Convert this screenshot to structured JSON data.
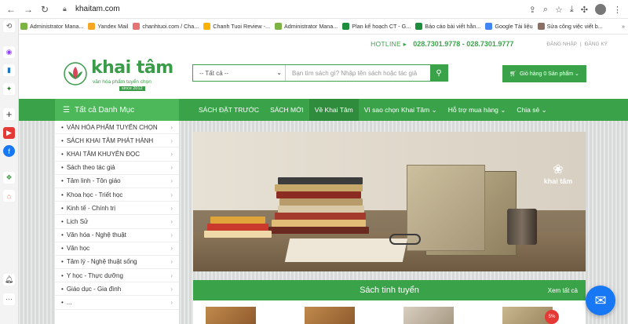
{
  "browser": {
    "url": "khaitam.com"
  },
  "bookmarks": [
    {
      "label": "Administrator Mana...",
      "color": "#7cb342"
    },
    {
      "label": "Yandex Mail",
      "color": "#f5a623"
    },
    {
      "label": "chanhtuoi.com / Cha...",
      "color": "#e57373"
    },
    {
      "label": "Chanh Tuoi Review -...",
      "color": "#ffb300"
    },
    {
      "label": "Administrator Mana...",
      "color": "#7cb342"
    },
    {
      "label": "Plan kế hoạch CT - G...",
      "color": "#1e8e3e"
    },
    {
      "label": "Báo cáo bài viết hằn...",
      "color": "#1e8e3e"
    },
    {
      "label": "Google Tài liệu",
      "color": "#4285f4"
    },
    {
      "label": "Sửa công việc viết b...",
      "color": "#8d6e63"
    }
  ],
  "topbar": {
    "hotline_label": "HOTLINE ▸",
    "hotline_number": "028.7301.9778 - 028.7301.9777",
    "login": "ĐĂNG NHẬP",
    "register": "ĐĂNG KÝ"
  },
  "logo": {
    "name": "khai tâm",
    "tagline": "văn hóa phẩm tuyển chọn",
    "since": "since 2012"
  },
  "search": {
    "category": "-- Tất cả --",
    "placeholder": "Bạn tìm sách gì? Nhập tên sách hoặc tác giả"
  },
  "cart": {
    "label": "Giỏ hàng 0 Sản phẩm ⌄"
  },
  "nav": {
    "all_categories": "Tất cả Danh Mục",
    "items": [
      {
        "label": "SÁCH ĐẶT TRƯỚC",
        "active": false
      },
      {
        "label": "SÁCH MỚI",
        "active": false
      },
      {
        "label": "Về Khai Tâm",
        "active": true
      },
      {
        "label": "Vì sao chọn Khai Tâm ⌄",
        "active": false
      },
      {
        "label": "Hỗ trợ mua hàng ⌄",
        "active": false
      },
      {
        "label": "Chia sẻ ⌄",
        "active": false
      }
    ]
  },
  "categories": [
    "VĂN HÓA PHẨM TUYỂN CHỌN",
    "SÁCH KHAI TÂM PHÁT HÀNH",
    "KHAI TÂM KHUYÊN ĐỌC",
    "Sách theo tác giả",
    "Tâm linh - Tôn giáo",
    "Khoa học - Triết học",
    "Kinh tế - Chính trị",
    "Lịch Sử",
    "Văn hóa - Nghệ thuật",
    "Văn học",
    "Tâm lý - Nghệ thuật sống",
    "Y học - Thực dưỡng",
    "Giáo dục - Gia đình",
    "..."
  ],
  "banner": {
    "brand": "khai tâm"
  },
  "featured": {
    "title": "Sách tinh tuyển",
    "view_all": "Xem tất cả",
    "discount_badge": "5%"
  }
}
